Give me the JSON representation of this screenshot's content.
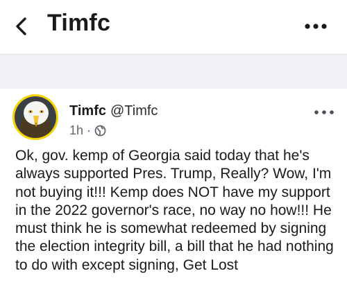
{
  "header": {
    "title": "Timfc",
    "icons": {
      "back": "chevron-left-icon",
      "more": "more-dots-icon"
    }
  },
  "post": {
    "author_name": "Timfc",
    "author_handle": "@Timfc",
    "time": "1h",
    "separator": "·",
    "privacy_icon": "globe-icon",
    "text_lines": [
      "Ok, gov. kemp of Georgia said today that he's",
      "always supported Pres. Trump, Really? Wow, I'm",
      "not buying it!!! Kemp does NOT have my support",
      "in the 2022 governor's race, no way no how!!! He",
      "must think he is somewhat redeemed by signing",
      "the election integrity bill, a bill that he had nothing",
      "to do with except signing, Get Lost"
    ]
  },
  "colors": {
    "accent_ring": "#f6d400",
    "divider": "#f0f2f5"
  }
}
